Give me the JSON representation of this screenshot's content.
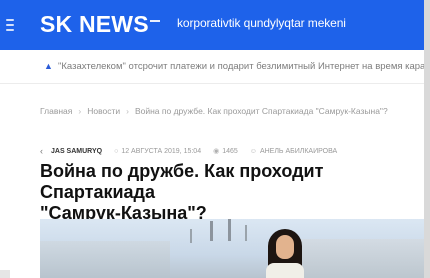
{
  "header": {
    "brand": "SK NEWS",
    "tagline": "korporativtik qundylyqtar mekeni",
    "background_color": "#1e62ea"
  },
  "ticker": {
    "icon": "megaphone-icon",
    "text": "\"Казахтелеком\" отсрочит платежи и подарит безлимитный Интернет на время карантина"
  },
  "breadcrumb": {
    "items": [
      "Главная",
      "Новости",
      "Война по дружбе. Как проходит Спартакиада \"Самрук-Казына\"?"
    ],
    "separator": "›"
  },
  "meta": {
    "back_icon": "‹",
    "author": "JAS SAMURYQ",
    "date": "12 АВГУСТА 2019, 15:04",
    "views": "1465",
    "writer": "АНЕЛЬ АБИЛКАИРОВА"
  },
  "article": {
    "title": "Война по дружбе. Как проходит Спартакиада\n\"Самрук-Қазына\"?"
  }
}
